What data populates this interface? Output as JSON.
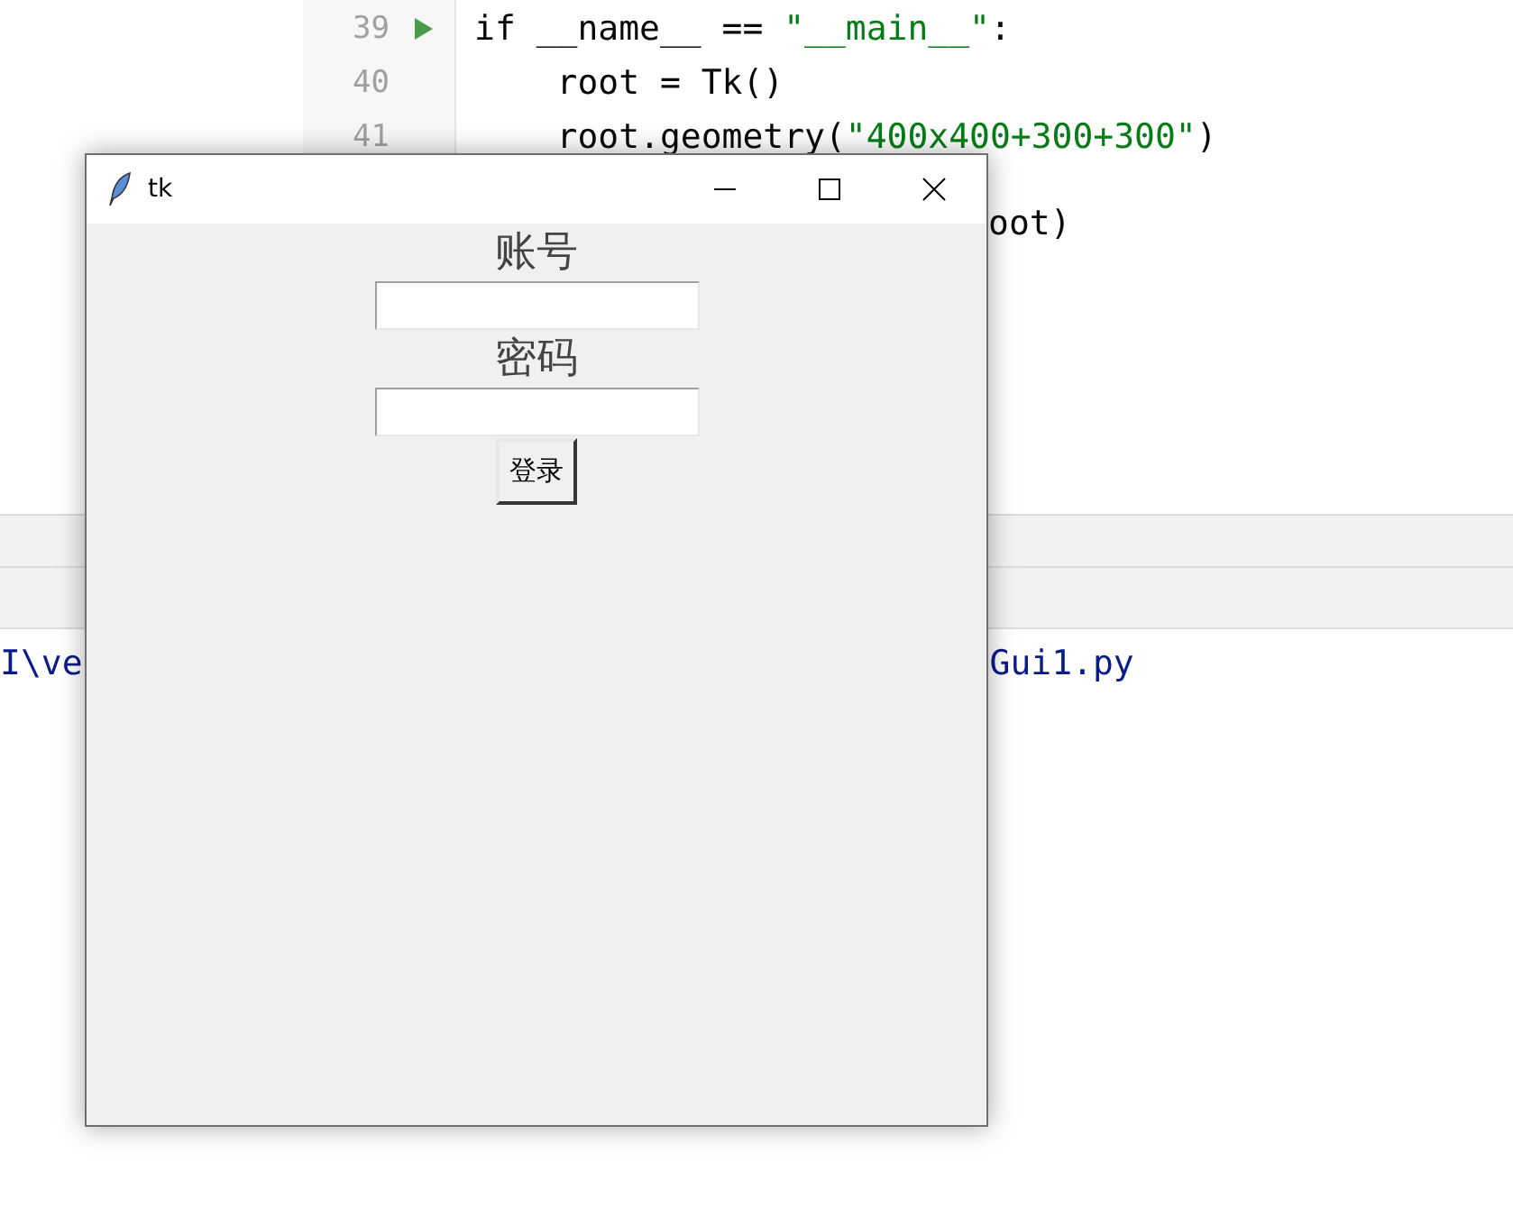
{
  "editor": {
    "lines": [
      {
        "kind": "code",
        "number": "39",
        "run": true,
        "text": "if __name__ == \"__main__\":"
      },
      {
        "kind": "code",
        "number": "40",
        "run": false,
        "text": "    root = Tk()"
      },
      {
        "kind": "code",
        "number": "41",
        "run": false,
        "text": "    root.geometry(\"400x400+300+300\")"
      },
      {
        "kind": "fragment",
        "text": "oot)"
      }
    ]
  },
  "console": {
    "fragments": [
      "I\\ve",
      "Gui1.py"
    ]
  },
  "tk_window": {
    "title": "tk",
    "form": [
      {
        "kind": "label",
        "text": "账号"
      },
      {
        "kind": "entry"
      },
      {
        "kind": "label",
        "text": "密码"
      },
      {
        "kind": "entry"
      },
      {
        "kind": "button",
        "text": "登录"
      }
    ]
  }
}
